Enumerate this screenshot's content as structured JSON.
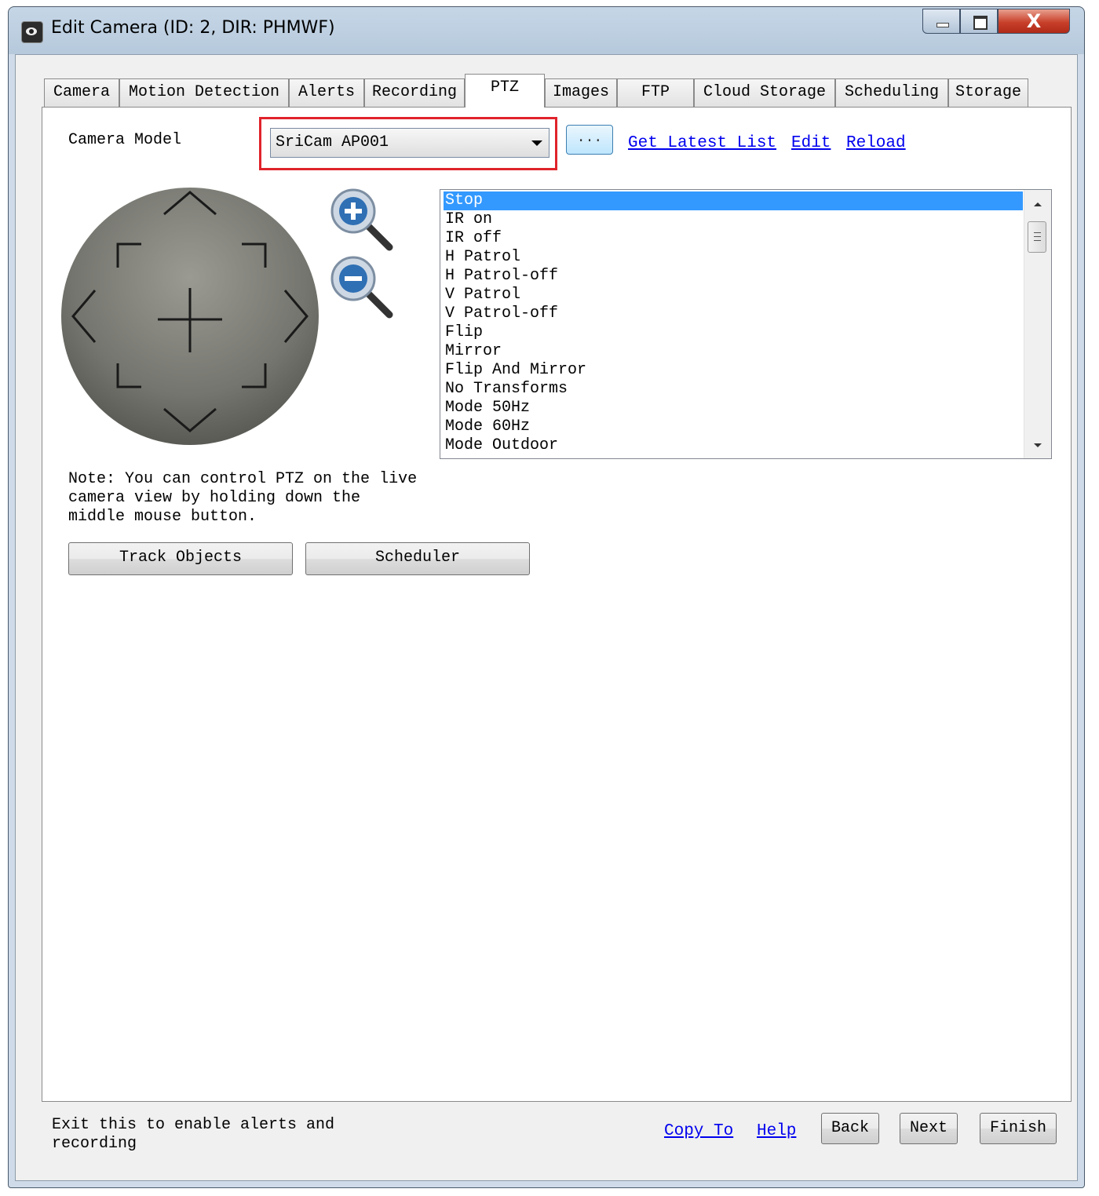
{
  "window": {
    "title": "Edit Camera (ID: 2, DIR: PHMWF)",
    "close_glyph": "X"
  },
  "tabs": [
    {
      "label": "Camera"
    },
    {
      "label": "Motion Detection"
    },
    {
      "label": "Alerts"
    },
    {
      "label": "Recording"
    },
    {
      "label": "PTZ"
    },
    {
      "label": "Images"
    },
    {
      "label": "FTP"
    },
    {
      "label": "Cloud Storage"
    },
    {
      "label": "Scheduling"
    },
    {
      "label": "Storage"
    }
  ],
  "ptz": {
    "camera_model_label": "Camera Model",
    "camera_model_value": "SriCam AP001",
    "browse_label": "...",
    "get_latest_label": "Get Latest List",
    "edit_label": "Edit",
    "reload_label": "Reload",
    "commands": [
      "Stop",
      "IR on",
      "IR off",
      "H Patrol",
      "H Patrol-off",
      "V Patrol",
      "V Patrol-off",
      "Flip",
      "Mirror",
      "Flip And Mirror",
      "No Transforms",
      "Mode 50Hz",
      "Mode 60Hz",
      "Mode Outdoor"
    ],
    "selected_command": "Stop",
    "note": "Note: You can control PTZ on the live\ncamera view by holding down the\nmiddle mouse button.",
    "track_objects_label": "Track Objects",
    "scheduler_label": "Scheduler"
  },
  "footer": {
    "note": "Exit this to enable alerts and\nrecording",
    "copy_to_label": "Copy To",
    "help_label": "Help",
    "back_label": "Back",
    "next_label": "Next",
    "finish_label": "Finish"
  },
  "icons": {
    "pad": "ptz-direction-pad",
    "zoom_in": "zoom-in-icon",
    "zoom_out": "zoom-out-icon"
  },
  "colors": {
    "selection": "#3399ff",
    "highlight_box": "#e0232b",
    "link": "#0000ee"
  }
}
